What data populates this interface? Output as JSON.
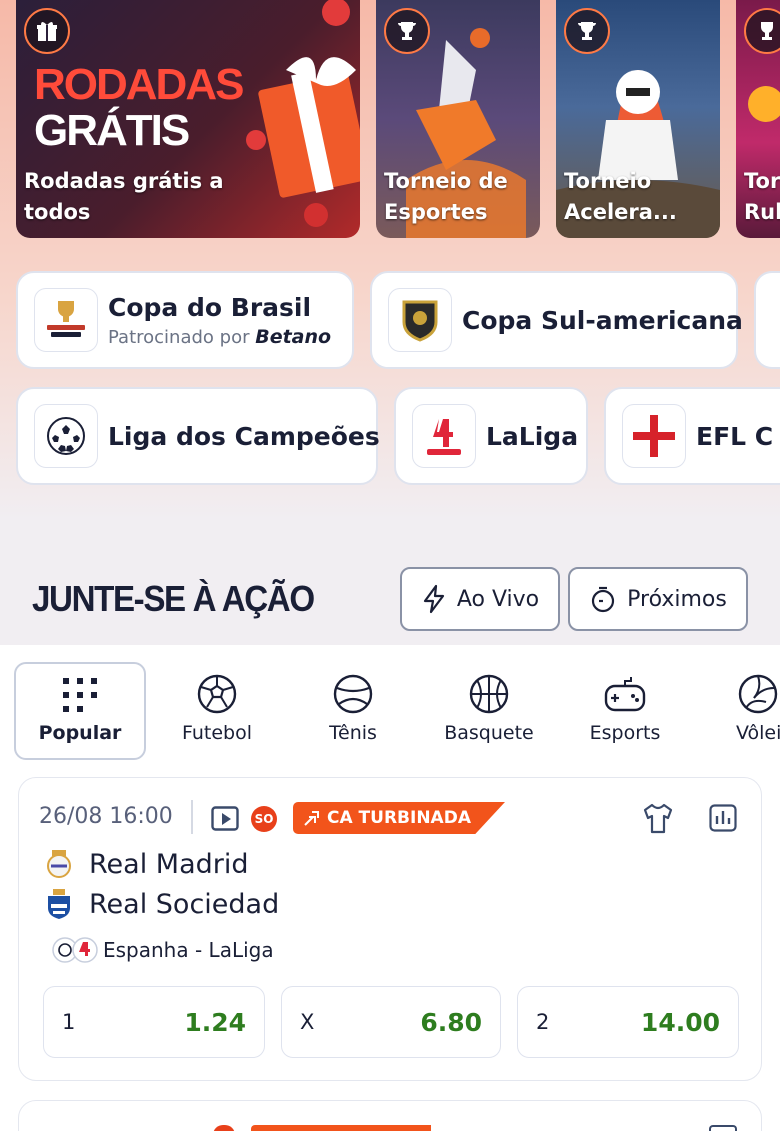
{
  "promos": [
    {
      "title_line1": "Rodadas grátis a",
      "title_line2": "todos",
      "art_line1": "RODADAS",
      "art_line2": "GRÁTIS",
      "badge_icon": "gift-icon"
    },
    {
      "title_line1": "Torneio de",
      "title_line2": "Esportes",
      "badge_icon": "trophy-icon"
    },
    {
      "title_line1": "Torneio",
      "title_line2": "Acelera...",
      "badge_icon": "trophy-icon"
    },
    {
      "title_line1": "Tor",
      "title_line2": "Rub",
      "badge_icon": "trophy-icon"
    }
  ],
  "leagues_row1": [
    {
      "name": "Copa do Brasil",
      "sponsor_prefix": "Patrocinado por",
      "sponsor_brand": "Betano",
      "icon": "copa-do-brasil-logo"
    },
    {
      "name": "Copa Sul-americana",
      "icon": "sul-americana-shield-logo"
    }
  ],
  "leagues_row2": [
    {
      "name": "Liga dos Campeões",
      "icon": "champions-league-ball-logo"
    },
    {
      "name": "LaLiga",
      "icon": "laliga-logo"
    },
    {
      "name": "EFL C",
      "icon": "england-flag-logo"
    }
  ],
  "section": {
    "title": "JUNTE-SE À AÇÃO",
    "live_label": "Ao Vivo",
    "upcoming_label": "Próximos"
  },
  "sports": [
    {
      "label": "Popular",
      "icon": "grid-icon"
    },
    {
      "label": "Futebol",
      "icon": "soccer-ball-icon"
    },
    {
      "label": "Tênis",
      "icon": "tennis-ball-icon"
    },
    {
      "label": "Basquete",
      "icon": "basketball-icon"
    },
    {
      "label": "Esports",
      "icon": "gamepad-icon"
    },
    {
      "label": "Vôlei",
      "icon": "volleyball-icon"
    }
  ],
  "event": {
    "datetime": "26/08 16:00",
    "so_badge": "SO",
    "boost_tag": "CA TURBINADA",
    "home": "Real Madrid",
    "away": "Real Sociedad",
    "league": "Espanha - LaLiga",
    "odds": [
      {
        "label": "1",
        "value": "1.24"
      },
      {
        "label": "X",
        "value": "6.80"
      },
      {
        "label": "2",
        "value": "14.00"
      }
    ]
  },
  "colors": {
    "accent": "#f2541b",
    "odds_green": "#2e7d1f",
    "text": "#1a1f36"
  }
}
